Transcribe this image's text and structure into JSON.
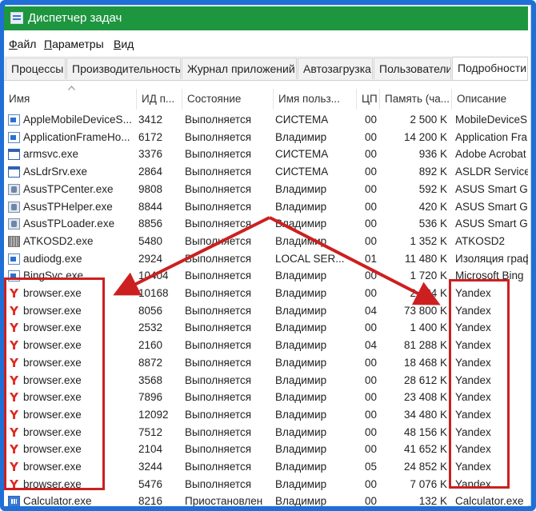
{
  "window": {
    "title": "Диспетчер задач"
  },
  "menu": [
    {
      "pre": "",
      "accel": "Ф",
      "post": "айл"
    },
    {
      "pre": "",
      "accel": "П",
      "post": "араметры"
    },
    {
      "pre": "",
      "accel": "В",
      "post": "ид"
    }
  ],
  "tabs": [
    "Процессы",
    "Производительность",
    "Журнал приложений",
    "Автозагрузка",
    "Пользователи",
    "Подробности"
  ],
  "active_tab": "Подробности",
  "columns": [
    "Имя",
    "ИД п...",
    "Состояние",
    "Имя польз...",
    "ЦП",
    "Память (ча...",
    "Описание"
  ],
  "processes": [
    {
      "icon": "app-icon",
      "name": "AppleMobileDeviceS...",
      "pid": "3412",
      "state": "Выполняется",
      "user": "СИСТЕМА",
      "cpu": "00",
      "mem": "2 500 K",
      "desc": "MobileDeviceS"
    },
    {
      "icon": "app-icon",
      "name": "ApplicationFrameHo...",
      "pid": "6172",
      "state": "Выполняется",
      "user": "Владимир",
      "cpu": "00",
      "mem": "14 200 K",
      "desc": "Application Fra"
    },
    {
      "icon": "window-icon",
      "name": "armsvc.exe",
      "pid": "3376",
      "state": "Выполняется",
      "user": "СИСТЕМА",
      "cpu": "00",
      "mem": "936 K",
      "desc": "Adobe Acrobat"
    },
    {
      "icon": "window-icon",
      "name": "AsLdrSrv.exe",
      "pid": "2864",
      "state": "Выполняется",
      "user": "СИСТЕМА",
      "cpu": "00",
      "mem": "892 K",
      "desc": "ASLDR Service"
    },
    {
      "icon": "asus-icon",
      "name": "AsusTPCenter.exe",
      "pid": "9808",
      "state": "Выполняется",
      "user": "Владимир",
      "cpu": "00",
      "mem": "592 K",
      "desc": "ASUS Smart Ge"
    },
    {
      "icon": "asus-icon",
      "name": "AsusTPHelper.exe",
      "pid": "8844",
      "state": "Выполняется",
      "user": "Владимир",
      "cpu": "00",
      "mem": "420 K",
      "desc": "ASUS Smart Ge"
    },
    {
      "icon": "asus-icon",
      "name": "AsusTPLoader.exe",
      "pid": "8856",
      "state": "Выполняется",
      "user": "Владимир",
      "cpu": "00",
      "mem": "536 K",
      "desc": "ASUS Smart Ge"
    },
    {
      "icon": "atk-icon",
      "name": "ATKOSD2.exe",
      "pid": "5480",
      "state": "Выполняется",
      "user": "Владимир",
      "cpu": "00",
      "mem": "1 352 K",
      "desc": "ATKOSD2"
    },
    {
      "icon": "app-icon",
      "name": "audiodg.exe",
      "pid": "2924",
      "state": "Выполняется",
      "user": "LOCAL SER...",
      "cpu": "01",
      "mem": "11 480 K",
      "desc": "Изоляция граф"
    },
    {
      "icon": "app-icon",
      "name": "BingSvc.exe",
      "pid": "10404",
      "state": "Выполняется",
      "user": "Владимир",
      "cpu": "00",
      "mem": "1 720 K",
      "desc": "Microsoft Bing"
    },
    {
      "icon": "yandex-icon",
      "name": "browser.exe",
      "pid": "10168",
      "state": "Выполняется",
      "user": "Владимир",
      "cpu": "00",
      "mem": "2 524 K",
      "desc": "Yandex"
    },
    {
      "icon": "yandex-icon",
      "name": "browser.exe",
      "pid": "8056",
      "state": "Выполняется",
      "user": "Владимир",
      "cpu": "04",
      "mem": "73 800 K",
      "desc": "Yandex"
    },
    {
      "icon": "yandex-icon",
      "name": "browser.exe",
      "pid": "2532",
      "state": "Выполняется",
      "user": "Владимир",
      "cpu": "00",
      "mem": "1 400 K",
      "desc": "Yandex"
    },
    {
      "icon": "yandex-icon",
      "name": "browser.exe",
      "pid": "2160",
      "state": "Выполняется",
      "user": "Владимир",
      "cpu": "04",
      "mem": "81 288 K",
      "desc": "Yandex"
    },
    {
      "icon": "yandex-icon",
      "name": "browser.exe",
      "pid": "8872",
      "state": "Выполняется",
      "user": "Владимир",
      "cpu": "00",
      "mem": "18 468 K",
      "desc": "Yandex"
    },
    {
      "icon": "yandex-icon",
      "name": "browser.exe",
      "pid": "3568",
      "state": "Выполняется",
      "user": "Владимир",
      "cpu": "00",
      "mem": "28 612 K",
      "desc": "Yandex"
    },
    {
      "icon": "yandex-icon",
      "name": "browser.exe",
      "pid": "7896",
      "state": "Выполняется",
      "user": "Владимир",
      "cpu": "00",
      "mem": "23 408 K",
      "desc": "Yandex"
    },
    {
      "icon": "yandex-icon",
      "name": "browser.exe",
      "pid": "12092",
      "state": "Выполняется",
      "user": "Владимир",
      "cpu": "00",
      "mem": "34 480 K",
      "desc": "Yandex"
    },
    {
      "icon": "yandex-icon",
      "name": "browser.exe",
      "pid": "7512",
      "state": "Выполняется",
      "user": "Владимир",
      "cpu": "00",
      "mem": "48 156 K",
      "desc": "Yandex"
    },
    {
      "icon": "yandex-icon",
      "name": "browser.exe",
      "pid": "2104",
      "state": "Выполняется",
      "user": "Владимир",
      "cpu": "00",
      "mem": "41 652 K",
      "desc": "Yandex"
    },
    {
      "icon": "yandex-icon",
      "name": "browser.exe",
      "pid": "3244",
      "state": "Выполняется",
      "user": "Владимир",
      "cpu": "05",
      "mem": "24 852 K",
      "desc": "Yandex"
    },
    {
      "icon": "yandex-icon",
      "name": "browser.exe",
      "pid": "5476",
      "state": "Выполняется",
      "user": "Владимир",
      "cpu": "00",
      "mem": "7 076 K",
      "desc": "Yandex"
    },
    {
      "icon": "calculator-icon",
      "name": "Calculator.exe",
      "pid": "8216",
      "state": "Приостановлен",
      "user": "Владимир",
      "cpu": "00",
      "mem": "132 K",
      "desc": "Calculator.exe"
    }
  ],
  "colors": {
    "titlebar": "#1e9640",
    "frame": "#1f6fd6",
    "highlight": "#cc2020",
    "yandex": "#e0261e"
  }
}
